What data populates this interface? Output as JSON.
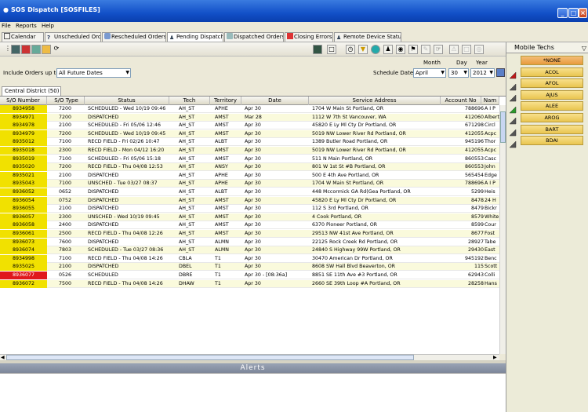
{
  "window": {
    "title": "SOS Dispatch  [SOSFILES]"
  },
  "menu": [
    "File",
    "Reports",
    "Help"
  ],
  "tabs": [
    "Calendar",
    "Unscheduled Orders",
    "Rescheduled Orders",
    "Pending Dispatch",
    "Dispatched Orders",
    "Closing Errors",
    "Remote Device Status"
  ],
  "filters": {
    "include_label": "Include Orders up to",
    "include_value": "All Future Dates",
    "schedule_label": "Schedule Date",
    "month_label": "Month",
    "day_label": "Day",
    "year_label": "Year",
    "month_value": "April",
    "day_value": "30",
    "year_value": "2012"
  },
  "subtab": "Central District (50)",
  "grid": {
    "headers": [
      "S/O Number",
      "S/O Type",
      "Status",
      "Tech",
      "Territory",
      "Date",
      "Service Address",
      "Account No",
      "Nam"
    ],
    "rows": [
      [
        "8934958",
        "7200",
        "SCHEDULED - Wed 10/19 09:46",
        "AH_ST",
        "APHE",
        "Apr 30",
        "1704 W Main St Portland, OR",
        "788696",
        "A I P"
      ],
      [
        "8934971",
        "7200",
        "DISPATCHED",
        "AH_ST",
        "AMST",
        "Mar 28",
        "1112 W 7th St Vancouver, WA",
        "412060",
        "Albert"
      ],
      [
        "8934978",
        "2100",
        "SCHEDULED - Fri 05/06 12:46",
        "AH_ST",
        "AMST",
        "Apr 30",
        "45820 E Ly Ml Cty Dr Portland, OR",
        "671298",
        "Circl"
      ],
      [
        "8934979",
        "7200",
        "SCHEDULED - Wed 10/19 09:45",
        "AH_ST",
        "AMST",
        "Apr 30",
        "5019 NW Lower River Rd Portland, OR",
        "412055",
        "Acpc"
      ],
      [
        "8935012",
        "7100",
        "RECD FIELD - Fri 02/26 10:47",
        "AH_ST",
        "ALBT",
        "Apr 30",
        "1389 Butler Road Portland, OR",
        "945196",
        "Thor"
      ],
      [
        "8935018",
        "2300",
        "RECD FIELD - Mon 04/12 16:20",
        "AH_ST",
        "AMST",
        "Apr 30",
        "5019 NW Lower River Rd Portland, OR",
        "412055",
        "Acpc"
      ],
      [
        "8935019",
        "7100",
        "SCHEDULED - Fri 05/06 15:18",
        "AH_ST",
        "AMST",
        "Apr 30",
        "511 N Main Portland, OR",
        "860553",
        "Casc"
      ],
      [
        "8935020",
        "7200",
        "RECD FIELD - Thu 04/08 12:53",
        "AH_ST",
        "ANSY",
        "Apr 30",
        "801 W 1st St #B Portland, OR",
        "860553",
        "John"
      ],
      [
        "8935021",
        "2100",
        "DISPATCHED",
        "AH_ST",
        "APHE",
        "Apr 30",
        "500 E 4th Ave Portland, OR",
        "565454",
        "Edge"
      ],
      [
        "8935043",
        "7100",
        "UNSCHED - Tue 03/27 08:37",
        "AH_ST",
        "APHE",
        "Apr 30",
        "1704 W Main St Portland, OR",
        "788696",
        "A I P"
      ],
      [
        "8936052",
        "0652",
        "DISPATCHED",
        "AH_ST",
        "ALBT",
        "Apr 30",
        "448 Mccormick GA Rd(Gea Portland, OR",
        "5299",
        "Heis"
      ],
      [
        "8936054",
        "0752",
        "DISPATCHED",
        "AH_ST",
        "AMST",
        "Apr 30",
        "45820 E Ly Ml Cty Dr Portland, OR",
        "8478",
        "24 H"
      ],
      [
        "8936055",
        "2100",
        "DISPATCHED",
        "AH_ST",
        "AMST",
        "Apr 30",
        "112 S 3rd Portland, OR",
        "8479",
        "Bickr"
      ],
      [
        "8936057",
        "2300",
        "UNSCHED - Wed 10/19 09:45",
        "AH_ST",
        "AMST",
        "Apr 30",
        "4 Cook Portland, OR",
        "8579",
        "White"
      ],
      [
        "8936058",
        "2400",
        "DISPATCHED",
        "AH_ST",
        "AMST",
        "Apr 30",
        "6370 Pioneer Portland, OR",
        "8599",
        "Cour"
      ],
      [
        "8936061",
        "2500",
        "RECD FIELD - Thu 04/08 12:26",
        "AH_ST",
        "AMST",
        "Apr 30",
        "29513 NW 41st Ave Portland, OR",
        "8677",
        "Fost"
      ],
      [
        "8936073",
        "7600",
        "DISPATCHED",
        "AH_ST",
        "ALMN",
        "Apr 30",
        "22125 Rock Creek Rd Portland, OR",
        "28927",
        "Tabe"
      ],
      [
        "8936074",
        "7803",
        "SCHEDULED - Tue 03/27 08:36",
        "AH_ST",
        "ALMN",
        "Apr 30",
        "24840 S Highway 99W Portland, OR",
        "29430",
        "East"
      ],
      [
        "8934998",
        "7100",
        "RECD FIELD - Thu 04/08 14:26",
        "CBLA",
        "T1",
        "Apr 30",
        "30470 American Dr Portland, OR",
        "945192",
        "Benc"
      ],
      [
        "8935025",
        "2100",
        "DISPATCHED",
        "DBEL",
        "T1",
        "Apr 30",
        "8608 SW Hall Blvd Beaverton, OR",
        "115",
        "Scott"
      ],
      [
        "8936077",
        "0526",
        "SCHEDULED",
        "DBRE",
        "T1",
        "Apr 30 - [08:36a]",
        "8851 SE 11th Ave #3 Portland, OR",
        "62943",
        "Colli"
      ],
      [
        "8936072",
        "7500",
        "RECD FIELD - Thu 04/08 14:26",
        "DHAW",
        "T1",
        "Apr 30",
        "2660 SE 39th Loop #A Portland, OR",
        "28258",
        "Hans"
      ]
    ],
    "red_row_index": 20
  },
  "alerts_title": "Alerts",
  "side": {
    "title": "Mobile Techs",
    "techs": [
      "*NONE",
      "ACOL",
      "AFOL",
      "AJUS",
      "ALEE",
      "AROG",
      "BART",
      "BDAI"
    ]
  },
  "colors": {
    "so_yellow": "#f1e100",
    "so_red": "#e0181c",
    "title_blue": "#1250c8"
  }
}
